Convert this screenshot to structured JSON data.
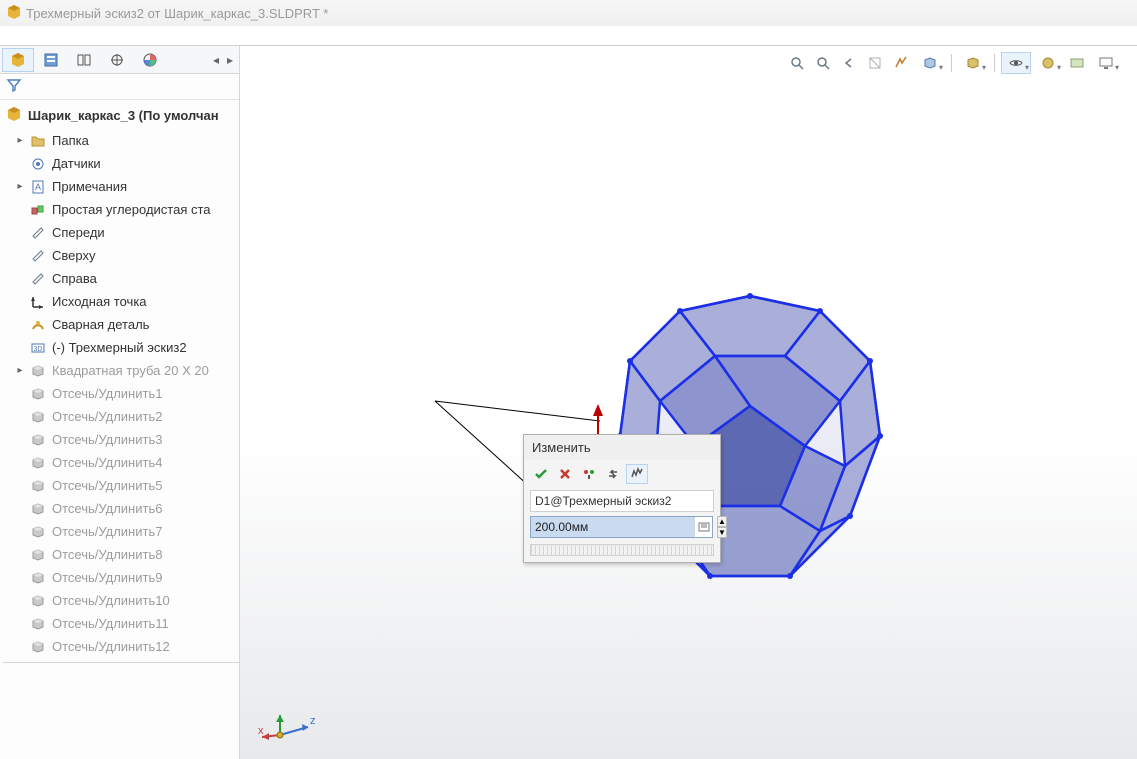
{
  "title": "Трехмерный эскиз2 от Шарик_каркас_3.SLDPRT *",
  "tree": {
    "root": "Шарик_каркас_3 (По умолчан",
    "items": [
      {
        "icon": "folder",
        "label": "Папка",
        "caret": true
      },
      {
        "icon": "sensor",
        "label": "Датчики"
      },
      {
        "icon": "note",
        "label": "Примечания",
        "caret": true
      },
      {
        "icon": "material",
        "label": "Простая углеродистая ста"
      },
      {
        "icon": "plane",
        "label": "Спереди"
      },
      {
        "icon": "plane",
        "label": "Сверху"
      },
      {
        "icon": "plane",
        "label": "Справа"
      },
      {
        "icon": "origin",
        "label": "Исходная точка"
      },
      {
        "icon": "weld",
        "label": "Сварная деталь"
      },
      {
        "icon": "sketch3d",
        "label": "(-) Трехмерный эскиз2"
      },
      {
        "icon": "body",
        "label": "Квадратная труба 20 X 20",
        "caret": true,
        "muted": true
      },
      {
        "icon": "body",
        "label": "Отсечь/Удлинить1",
        "muted": true
      },
      {
        "icon": "body",
        "label": "Отсечь/Удлинить2",
        "muted": true
      },
      {
        "icon": "body",
        "label": "Отсечь/Удлинить3",
        "muted": true
      },
      {
        "icon": "body",
        "label": "Отсечь/Удлинить4",
        "muted": true
      },
      {
        "icon": "body",
        "label": "Отсечь/Удлинить5",
        "muted": true
      },
      {
        "icon": "body",
        "label": "Отсечь/Удлинить6",
        "muted": true
      },
      {
        "icon": "body",
        "label": "Отсечь/Удлинить7",
        "muted": true
      },
      {
        "icon": "body",
        "label": "Отсечь/Удлинить8",
        "muted": true
      },
      {
        "icon": "body",
        "label": "Отсечь/Удлинить9",
        "muted": true
      },
      {
        "icon": "body",
        "label": "Отсечь/Удлинить10",
        "muted": true
      },
      {
        "icon": "body",
        "label": "Отсечь/Удлинить11",
        "muted": true
      },
      {
        "icon": "body",
        "label": "Отсечь/Удлинить12",
        "muted": true
      }
    ]
  },
  "dialog": {
    "title": "Изменить",
    "dim_name": "D1@Трехмерный эскиз2",
    "value": "200.00мм"
  },
  "triad": {
    "x": "x",
    "z": "z"
  },
  "view_toolbar": {
    "items": [
      {
        "name": "zoom-fit-icon"
      },
      {
        "name": "zoom-area-icon"
      },
      {
        "name": "previous-view-icon"
      },
      {
        "name": "section-view-icon"
      },
      {
        "name": "dynamic-annotation-icon"
      },
      {
        "name": "display-style-icon",
        "dd": true
      },
      {
        "sep": true
      },
      {
        "name": "view-orientation-icon",
        "dd": true
      },
      {
        "sep": true
      },
      {
        "name": "hide-show-icon",
        "dd": true,
        "active": true
      },
      {
        "name": "appearance-icon",
        "dd": true
      },
      {
        "name": "scene-icon"
      },
      {
        "name": "view-settings-icon",
        "dd": true
      }
    ]
  }
}
